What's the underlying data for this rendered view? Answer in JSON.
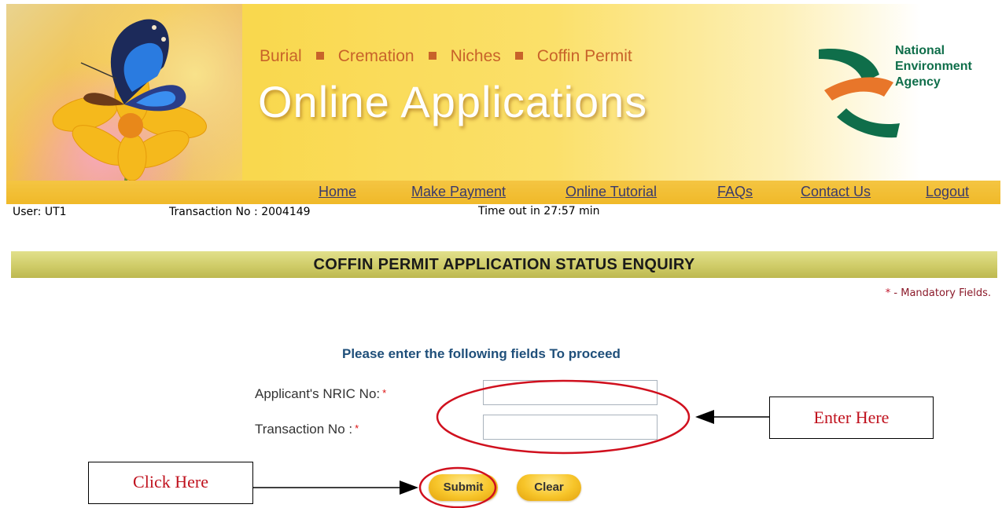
{
  "banner": {
    "categories": [
      "Burial",
      "Cremation",
      "Niches",
      "Coffin Permit"
    ],
    "title": "Online Applications",
    "agency_name_line1": "National",
    "agency_name_line2": "Environment",
    "agency_name_line3": "Agency",
    "brand_colors": {
      "banner": "#f9d84e",
      "category_text": "#c8632a",
      "agency": "#0f6e4a"
    }
  },
  "nav": {
    "home": "Home",
    "make_payment": "Make Payment",
    "online_tutorial": "Online Tutorial",
    "faqs": "FAQs",
    "contact_us": "Contact Us",
    "logout": "Logout"
  },
  "session": {
    "user": "User: UT1",
    "transaction": "Transaction No : 2004149",
    "timeout": "Time out in 27:57 min"
  },
  "page": {
    "section_title": "COFFIN PERMIT APPLICATION STATUS ENQUIRY",
    "mandatory_star": "*",
    "mandatory_note": " - Mandatory Fields."
  },
  "form": {
    "prompt": "Please enter the following fields To proceed",
    "nric_label": "Applicant's NRIC No:",
    "transaction_label": "Transaction No :",
    "required_marker": "*",
    "nric_value": "",
    "transaction_value": "",
    "submit_label": "Submit",
    "clear_label": "Clear"
  },
  "annotations": {
    "enter_here": "Enter Here",
    "click_here": "Click Here",
    "highlight_color": "#d0101e"
  },
  "icons": [
    "butterfly-flower-image",
    "nea-logo-icon",
    "arrow-left-icon",
    "arrow-right-icon"
  ]
}
